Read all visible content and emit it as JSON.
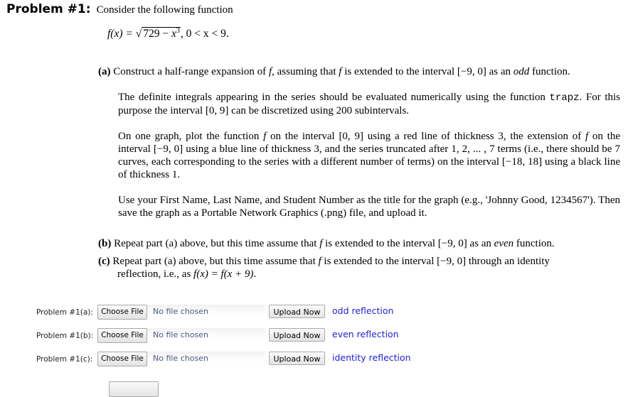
{
  "heading": {
    "title": "Problem #1:",
    "lead": "Consider the following function"
  },
  "formula": {
    "lhs": "f(x) = ",
    "radicand_const": "729 − ",
    "radicand_var": "x",
    "exponent": "3",
    "domain": ",  0 < x < 9."
  },
  "part_a": {
    "label": "(a)",
    "text_1": "Construct a half-range expansion of ",
    "f1": "f",
    "text_2": ", assuming that ",
    "f2": "f",
    "text_3": " is extended to the interval [−9, 0] as an ",
    "emph": "odd",
    "text_4": " function."
  },
  "para_trapz": {
    "text_1": "The definite integrals appearing in the series should be evaluated numerically using the function ",
    "code": "trapz",
    "text_2": ". For this purpose the interval [0, 9] can be discretized using 200 subintervals."
  },
  "para_plot": {
    "text_1": "On one graph, plot the function ",
    "f1": "f",
    "text_2": " on the interval [0, 9] using a red line of thickness 3, the extension of ",
    "f2": "f",
    "text_3": " on the interval [−9, 0] using a blue line of thickness 3, and the series truncated after 1, 2, ... , 7 terms (i.e., there should be 7 curves, each corresponding to the series with a different number of terms) on the interval [−18, 18] using a black line of thickness 1."
  },
  "para_title": {
    "text": "Use your First Name, Last Name, and Student Number as the title for the graph (e.g., 'Johnny Good, 1234567'). Then save the graph as a Portable Network Graphics (.png) file, and upload it."
  },
  "part_b": {
    "label": "(b)",
    "text_1": "Repeat part (a) above, but this time assume that ",
    "f1": "f",
    "text_2": " is extended to the interval [−9, 0] as an ",
    "emph": "even",
    "text_3": " function."
  },
  "part_c": {
    "label": "(c)",
    "text_1": "Repeat part (a) above, but this time assume that ",
    "f1": "f",
    "text_2": " is extended to the interval [−9, 0] through an identity",
    "text_3": "reflection, i.e., as ",
    "eq": "f(x) = f(x + 9)",
    "text_4": "."
  },
  "uploads": [
    {
      "label": "Problem #1(a):",
      "choose": "Choose File",
      "status": "No file chosen",
      "upload": "Upload Now",
      "link": "odd reflection"
    },
    {
      "label": "Problem #1(b):",
      "choose": "Choose File",
      "status": "No file chosen",
      "upload": "Upload Now",
      "link": "even reflection"
    },
    {
      "label": "Problem #1(c):",
      "choose": "Choose File",
      "status": "No file chosen",
      "upload": "Upload Now",
      "link": "identity reflection"
    }
  ],
  "colors": {
    "link": "#2222cc",
    "no_file_text": "#4a5a80"
  }
}
